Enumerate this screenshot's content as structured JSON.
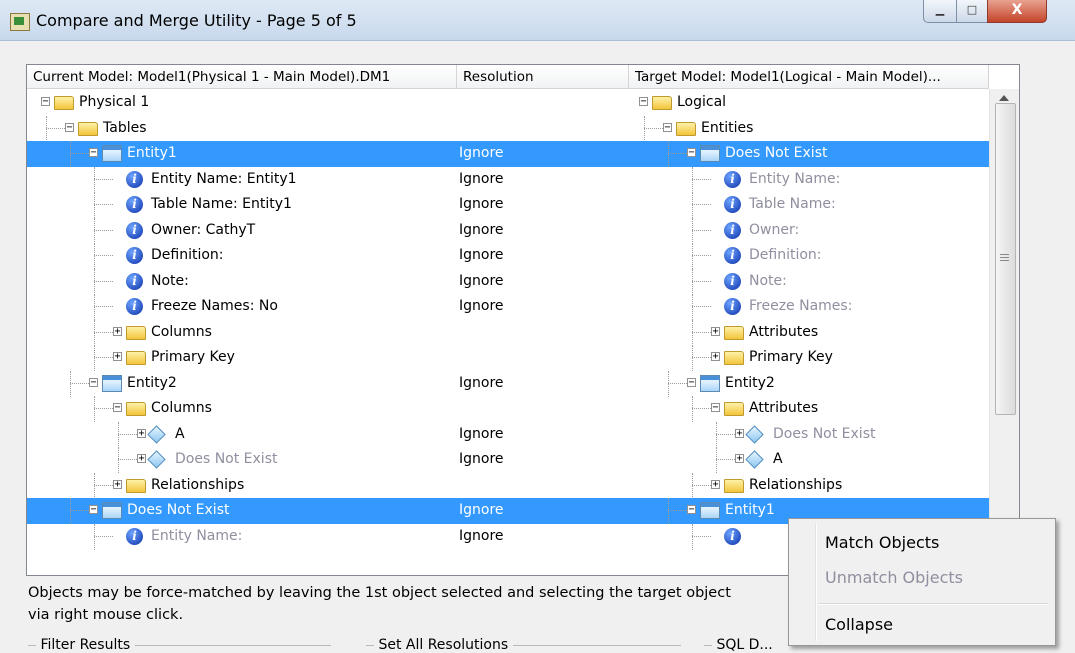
{
  "window": {
    "title": "Compare and Merge Utility  - Page 5 of 5",
    "min_glyph": "▁",
    "max_glyph": "□",
    "close_glyph": "X"
  },
  "columns": {
    "current": "Current Model: Model1(Physical 1 - Main Model).DM1",
    "resolution": "Resolution",
    "target": "Target Model: Model1(Logical - Main Model)..."
  },
  "rows": [
    {
      "left": {
        "text": "Physical 1",
        "icon": "folder-icon",
        "indent": 0,
        "expander": "−",
        "gray": false
      },
      "resolution": "",
      "right": {
        "text": "Logical",
        "icon": "folder-icon",
        "indent": 0,
        "expander": "−",
        "gray": false
      },
      "selected": false
    },
    {
      "left": {
        "text": "Tables",
        "icon": "folder-icon",
        "indent": 1,
        "expander": "−",
        "gray": false
      },
      "resolution": "",
      "right": {
        "text": "Entities",
        "icon": "folder-icon",
        "indent": 1,
        "expander": "−",
        "gray": false
      },
      "selected": false
    },
    {
      "left": {
        "text": "Entity1",
        "icon": "table-icon",
        "indent": 2,
        "expander": "−",
        "gray": false
      },
      "resolution": "Ignore",
      "right": {
        "text": "Does Not Exist",
        "icon": "table-icon",
        "indent": 2,
        "expander": "−",
        "gray": false
      },
      "selected": true
    },
    {
      "left": {
        "text": "Entity Name: Entity1",
        "icon": "info-icon",
        "indent": 3,
        "expander": "",
        "gray": false
      },
      "resolution": "Ignore",
      "right": {
        "text": "Entity Name:",
        "icon": "info-icon",
        "indent": 3,
        "expander": "",
        "gray": true
      },
      "selected": false
    },
    {
      "left": {
        "text": "Table Name: Entity1",
        "icon": "info-icon",
        "indent": 3,
        "expander": "",
        "gray": false
      },
      "resolution": "Ignore",
      "right": {
        "text": "Table Name:",
        "icon": "info-icon",
        "indent": 3,
        "expander": "",
        "gray": true
      },
      "selected": false
    },
    {
      "left": {
        "text": "Owner: CathyT",
        "icon": "info-icon",
        "indent": 3,
        "expander": "",
        "gray": false
      },
      "resolution": "Ignore",
      "right": {
        "text": "Owner:",
        "icon": "info-icon",
        "indent": 3,
        "expander": "",
        "gray": true
      },
      "selected": false
    },
    {
      "left": {
        "text": "Definition:",
        "icon": "info-icon",
        "indent": 3,
        "expander": "",
        "gray": false
      },
      "resolution": "Ignore",
      "right": {
        "text": "Definition:",
        "icon": "info-icon",
        "indent": 3,
        "expander": "",
        "gray": true
      },
      "selected": false
    },
    {
      "left": {
        "text": "Note:",
        "icon": "info-icon",
        "indent": 3,
        "expander": "",
        "gray": false
      },
      "resolution": "Ignore",
      "right": {
        "text": "Note:",
        "icon": "info-icon",
        "indent": 3,
        "expander": "",
        "gray": true
      },
      "selected": false
    },
    {
      "left": {
        "text": "Freeze Names: No",
        "icon": "info-icon",
        "indent": 3,
        "expander": "",
        "gray": false
      },
      "resolution": "Ignore",
      "right": {
        "text": "Freeze Names:",
        "icon": "info-icon",
        "indent": 3,
        "expander": "",
        "gray": true
      },
      "selected": false
    },
    {
      "left": {
        "text": "Columns",
        "icon": "folder-icon",
        "indent": 3,
        "expander": "+",
        "gray": false
      },
      "resolution": "",
      "right": {
        "text": "Attributes",
        "icon": "folder-icon",
        "indent": 3,
        "expander": "+",
        "gray": false
      },
      "selected": false
    },
    {
      "left": {
        "text": "Primary Key",
        "icon": "folder-icon",
        "indent": 3,
        "expander": "+",
        "gray": false
      },
      "resolution": "",
      "right": {
        "text": "Primary Key",
        "icon": "folder-icon",
        "indent": 3,
        "expander": "+",
        "gray": false
      },
      "selected": false
    },
    {
      "left": {
        "text": "Entity2",
        "icon": "table-icon",
        "indent": 2,
        "expander": "−",
        "gray": false
      },
      "resolution": "Ignore",
      "right": {
        "text": "Entity2",
        "icon": "table-icon",
        "indent": 2,
        "expander": "−",
        "gray": false
      },
      "selected": false
    },
    {
      "left": {
        "text": "Columns",
        "icon": "folder-icon",
        "indent": 3,
        "expander": "−",
        "gray": false
      },
      "resolution": "",
      "right": {
        "text": "Attributes",
        "icon": "folder-icon",
        "indent": 3,
        "expander": "−",
        "gray": false
      },
      "selected": false
    },
    {
      "left": {
        "text": "A",
        "icon": "diamond-icon",
        "indent": 4,
        "expander": "+",
        "gray": false
      },
      "resolution": "Ignore",
      "right": {
        "text": "Does Not Exist",
        "icon": "diamond-icon",
        "indent": 4,
        "expander": "+",
        "gray": true
      },
      "selected": false
    },
    {
      "left": {
        "text": "Does Not Exist",
        "icon": "diamond-icon",
        "indent": 4,
        "expander": "+",
        "gray": true
      },
      "resolution": "Ignore",
      "right": {
        "text": "A",
        "icon": "diamond-icon",
        "indent": 4,
        "expander": "+",
        "gray": false
      },
      "selected": false
    },
    {
      "left": {
        "text": "Relationships",
        "icon": "folder-icon",
        "indent": 3,
        "expander": "+",
        "gray": false
      },
      "resolution": "",
      "right": {
        "text": "Relationships",
        "icon": "folder-icon",
        "indent": 3,
        "expander": "+",
        "gray": false
      },
      "selected": false
    },
    {
      "left": {
        "text": "Does Not Exist",
        "icon": "table-icon",
        "indent": 2,
        "expander": "−",
        "gray": false
      },
      "resolution": "Ignore",
      "right": {
        "text": "Entity1",
        "icon": "table-icon",
        "indent": 2,
        "expander": "−",
        "gray": false
      },
      "selected": true
    },
    {
      "left": {
        "text": "Entity Name:",
        "icon": "info-icon",
        "indent": 3,
        "expander": "",
        "gray": true
      },
      "resolution": "Ignore",
      "right": {
        "text": "",
        "icon": "info-icon",
        "indent": 3,
        "expander": "",
        "gray": false
      },
      "selected": false
    }
  ],
  "help_text_line1": "Objects may be force-matched by leaving the 1st object selected and selecting the target object",
  "help_text_line2": "via right mouse click.",
  "groups": {
    "filter": "Filter Results",
    "set_all": "Set All Resolutions",
    "sql": "SQL D..."
  },
  "context_menu": {
    "match": "Match Objects",
    "unmatch": "Unmatch Objects",
    "collapse": "Collapse"
  },
  "colors": {
    "selection": "#3399ff",
    "disabled_text": "#8f8f9f"
  }
}
